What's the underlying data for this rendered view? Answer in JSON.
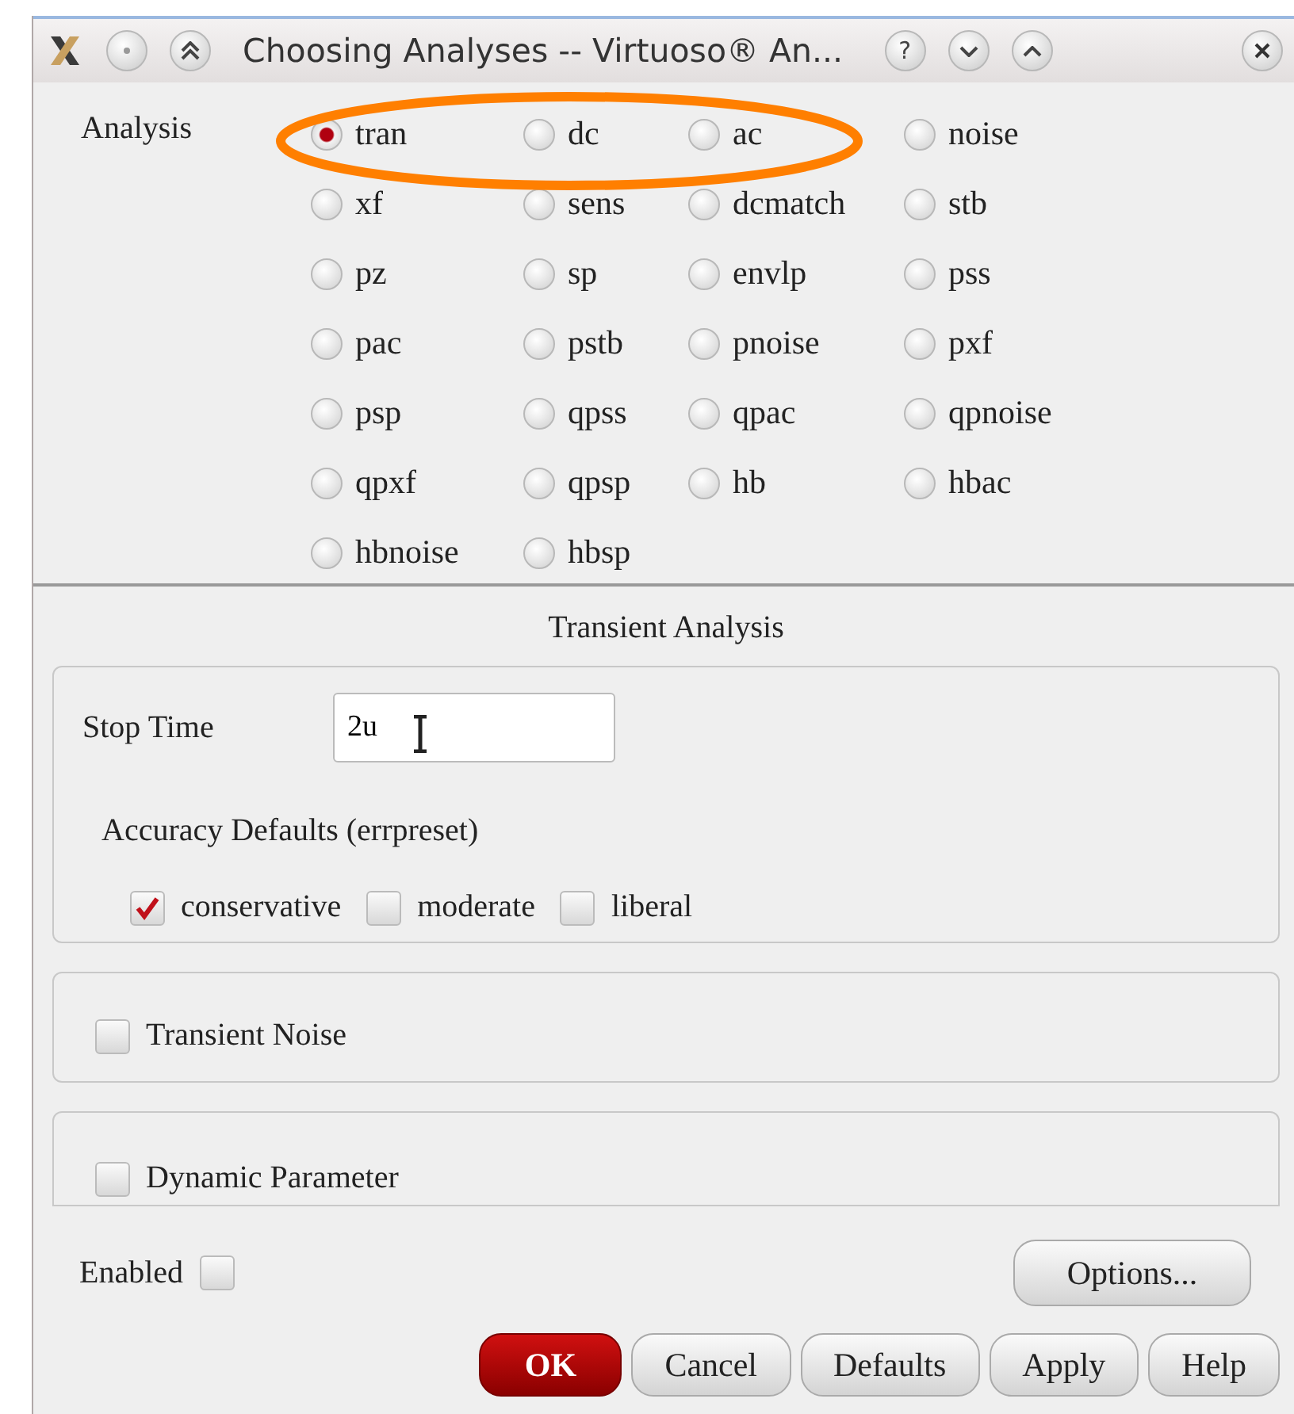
{
  "window": {
    "title": "Choosing Analyses -- Virtuoso® An...",
    "help_glyph": "?"
  },
  "analysis": {
    "label": "Analysis",
    "options": [
      {
        "label": "tran",
        "selected": true
      },
      {
        "label": "dc",
        "selected": false
      },
      {
        "label": "ac",
        "selected": false
      },
      {
        "label": "noise",
        "selected": false
      },
      {
        "label": "xf",
        "selected": false
      },
      {
        "label": "sens",
        "selected": false
      },
      {
        "label": "dcmatch",
        "selected": false
      },
      {
        "label": "stb",
        "selected": false
      },
      {
        "label": "pz",
        "selected": false
      },
      {
        "label": "sp",
        "selected": false
      },
      {
        "label": "envlp",
        "selected": false
      },
      {
        "label": "pss",
        "selected": false
      },
      {
        "label": "pac",
        "selected": false
      },
      {
        "label": "pstb",
        "selected": false
      },
      {
        "label": "pnoise",
        "selected": false
      },
      {
        "label": "pxf",
        "selected": false
      },
      {
        "label": "psp",
        "selected": false
      },
      {
        "label": "qpss",
        "selected": false
      },
      {
        "label": "qpac",
        "selected": false
      },
      {
        "label": "qpnoise",
        "selected": false
      },
      {
        "label": "qpxf",
        "selected": false
      },
      {
        "label": "qpsp",
        "selected": false
      },
      {
        "label": "hb",
        "selected": false
      },
      {
        "label": "hbac",
        "selected": false
      },
      {
        "label": "hbnoise",
        "selected": false
      },
      {
        "label": "hbsp",
        "selected": false
      }
    ]
  },
  "section_title": "Transient Analysis",
  "stop_time": {
    "label": "Stop Time",
    "value": "2u"
  },
  "accuracy": {
    "label": "Accuracy Defaults (errpreset)",
    "options": [
      {
        "label": "conservative",
        "checked": true
      },
      {
        "label": "moderate",
        "checked": false
      },
      {
        "label": "liberal",
        "checked": false
      }
    ]
  },
  "transient_noise": {
    "label": "Transient Noise",
    "checked": false
  },
  "dynamic_parameter": {
    "label": "Dynamic Parameter",
    "checked": false
  },
  "enabled": {
    "label": "Enabled",
    "checked": false
  },
  "options_button": "Options...",
  "buttons": [
    {
      "label": "OK",
      "kind": "primary"
    },
    {
      "label": "Cancel",
      "kind": "normal"
    },
    {
      "label": "Defaults",
      "kind": "normal"
    },
    {
      "label": "Apply",
      "kind": "normal"
    },
    {
      "label": "Help",
      "kind": "normal"
    }
  ]
}
